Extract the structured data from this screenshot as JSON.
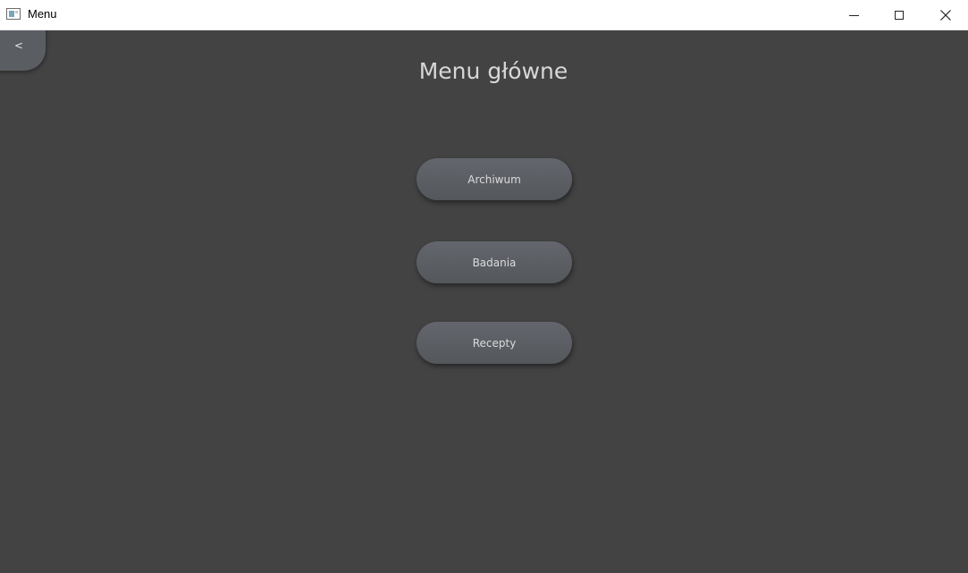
{
  "window": {
    "title": "Menu"
  },
  "page": {
    "back_label": "<",
    "title": "Menu główne"
  },
  "menu": {
    "items": [
      {
        "label": "Archiwum"
      },
      {
        "label": "Badania"
      },
      {
        "label": "Recepty"
      }
    ]
  },
  "colors": {
    "background": "#434343",
    "button": "#5a5d62",
    "title_text": "#d7d7d7"
  }
}
